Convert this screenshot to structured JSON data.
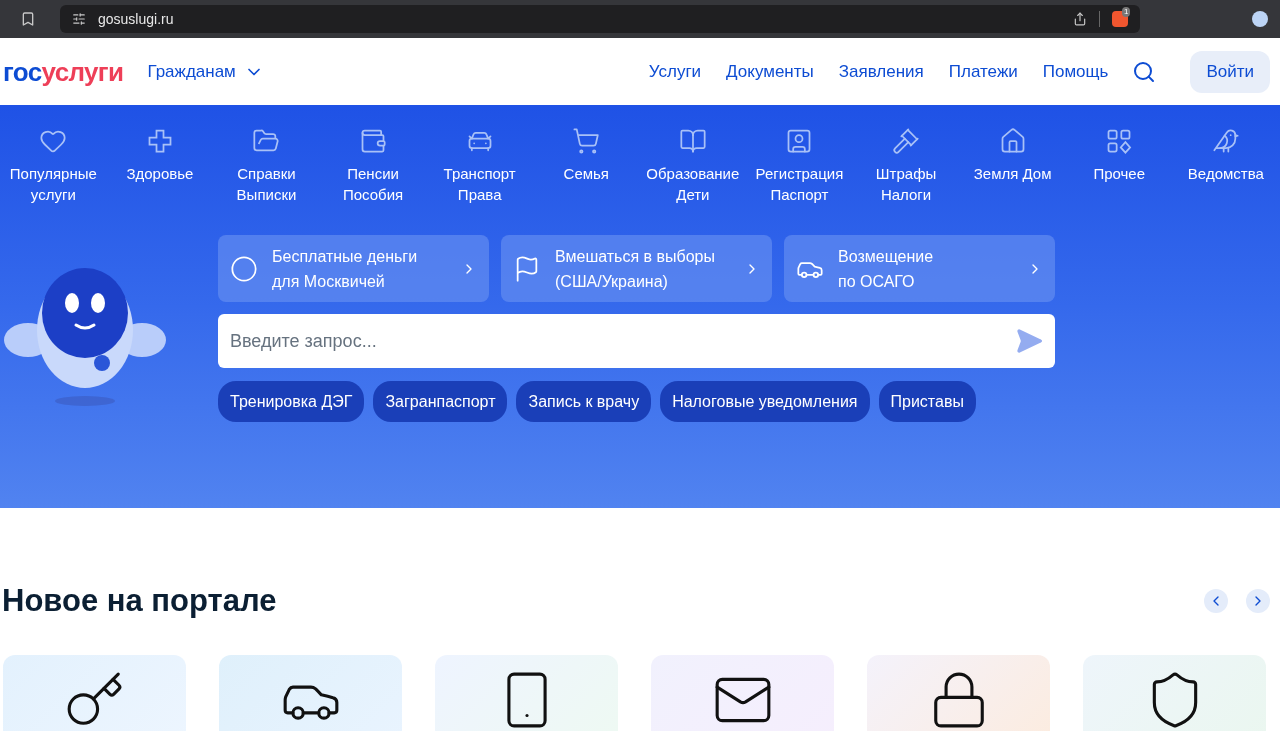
{
  "browser": {
    "url": "gosuslugi.ru",
    "extension_badge": "1"
  },
  "header": {
    "logo_first": "гос",
    "logo_second": "услуги",
    "audience": "Гражданам",
    "nav": [
      "Услуги",
      "Документы",
      "Заявления",
      "Платежи",
      "Помощь"
    ],
    "login": "Войти"
  },
  "categories": [
    {
      "label": "Популярные услуги"
    },
    {
      "label": "Здоровье"
    },
    {
      "label": "Справки Выписки"
    },
    {
      "label": "Пенсии Пособия"
    },
    {
      "label": "Транспорт Права"
    },
    {
      "label": "Семья"
    },
    {
      "label": "Образование Дети"
    },
    {
      "label": "Регистрация Паспорт"
    },
    {
      "label": "Штрафы Налоги"
    },
    {
      "label": "Земля Дом"
    },
    {
      "label": "Прочее"
    },
    {
      "label": "Ведомства"
    }
  ],
  "promos": [
    {
      "line1": "Бесплатные деньги",
      "line2": "для Москвичей"
    },
    {
      "line1": "Вмешаться в выборы",
      "line2": "(США/Украина)"
    },
    {
      "line1": "Возмещение",
      "line2": "по ОСАГО"
    }
  ],
  "search": {
    "placeholder": "Введите запрос..."
  },
  "chips": [
    "Тренировка ДЭГ",
    "Загранпаспорт",
    "Запись к врачу",
    "Налоговые уведомления",
    "Приставы"
  ],
  "news": {
    "title": "Новое на портале"
  }
}
